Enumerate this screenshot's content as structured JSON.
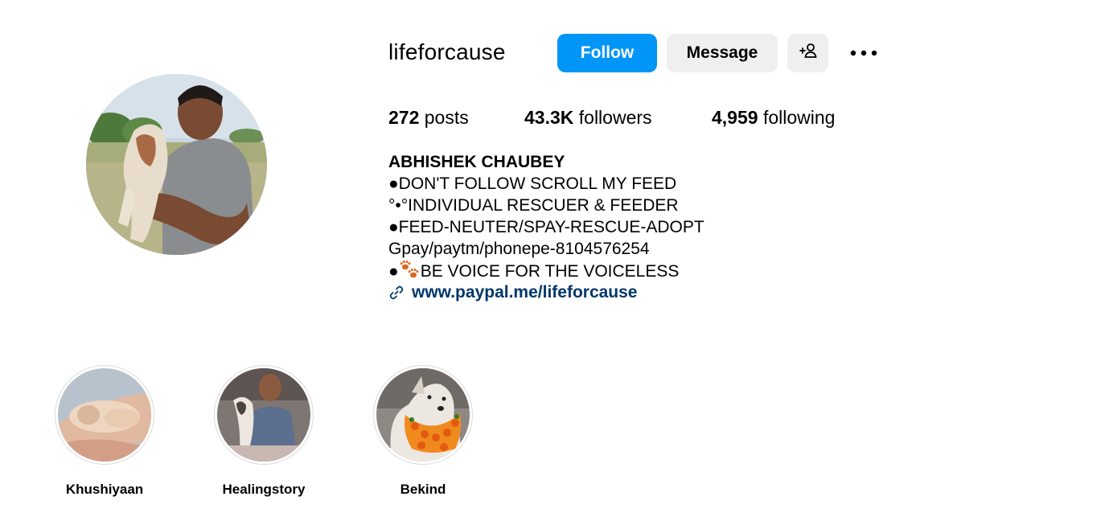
{
  "profile": {
    "username": "lifeforcause",
    "avatar_icon": "profile-photo",
    "buttons": {
      "follow_label": "Follow",
      "message_label": "Message",
      "suggest_icon": "add-person-icon",
      "more_icon": "more-options-icon"
    },
    "stats": {
      "posts_count": "272",
      "posts_label": "posts",
      "followers_count": "43.3K",
      "followers_label": "followers",
      "following_count": "4,959",
      "following_label": "following"
    },
    "bio": {
      "name": "ABHISHEK CHAUBEY",
      "lines": [
        "●DON'T FOLLOW SCROLL MY FEED",
        "°•°INDIVIDUAL RESCUER & FEEDER",
        "●FEED-NEUTER/SPAY-RESCUE-ADOPT",
        "Gpay/paytm/phonepe-8104576254"
      ],
      "last_line_prefix": "●",
      "last_line_icon": "paw-prints-emoji",
      "last_line_text": "BE VOICE FOR THE VOICELESS",
      "link_icon": "link-icon",
      "link_text": "www.paypal.me/lifeforcause"
    }
  },
  "highlights": [
    {
      "label": "Khushiyaan"
    },
    {
      "label": "Healingstory"
    },
    {
      "label": "Bekind"
    }
  ],
  "colors": {
    "follow_button": "#0095f6",
    "secondary_button": "#efefef",
    "link": "#00376b",
    "ring": "#dbdbdb"
  }
}
